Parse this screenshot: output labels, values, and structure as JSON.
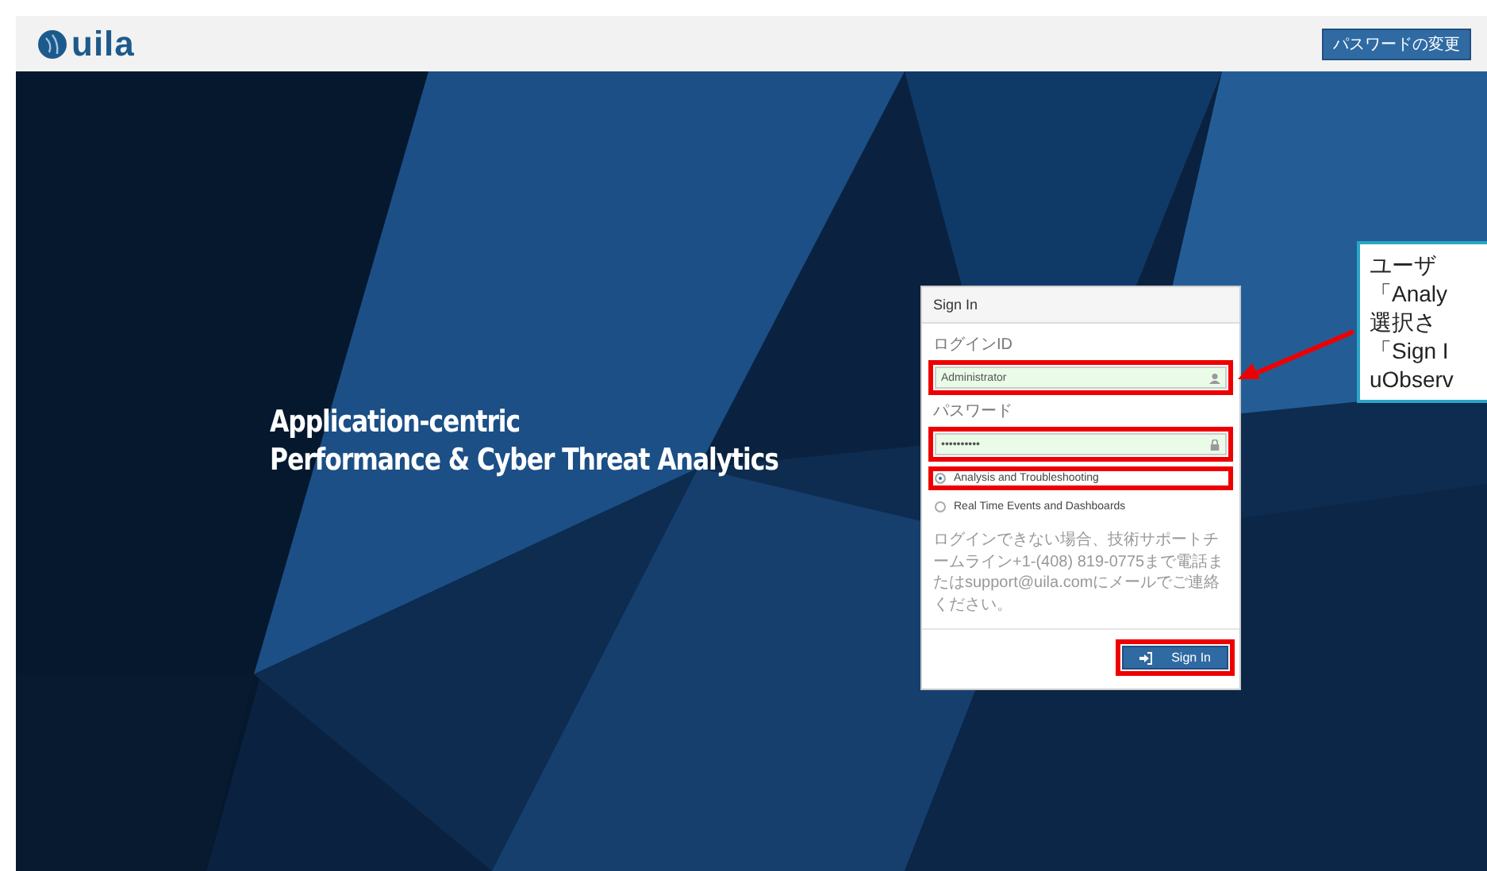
{
  "header": {
    "logo": "uila",
    "button": "パスワードの変更"
  },
  "tagline": [
    "Application-centric",
    "Performance & Cyber Threat Analytics"
  ],
  "signin": {
    "title": "Sign In",
    "fields": [
      {
        "label": "ログインID",
        "value": "Administrator",
        "kind": "user",
        "highlighted": true
      },
      {
        "label": "パスワード",
        "value": "••••••••••",
        "kind": "lock",
        "highlighted": true
      }
    ],
    "options": [
      {
        "label": "Analysis and Troubleshooting",
        "selected": true,
        "highlighted": true
      },
      {
        "label": "Real Time Events and Dashboards",
        "selected": false,
        "highlighted": false
      }
    ],
    "note": "ログインできない場合、技術サポートチームライン+1-(408) 819-0775まで電話またはsupport@uila.comにメールでご連絡ください。",
    "button": {
      "label": "Sign In",
      "highlighted": true
    }
  },
  "callout": {
    "lines": [
      "ユーザ",
      "「Analy",
      "選択さ",
      "「Sign I",
      "uObserv"
    ]
  }
}
